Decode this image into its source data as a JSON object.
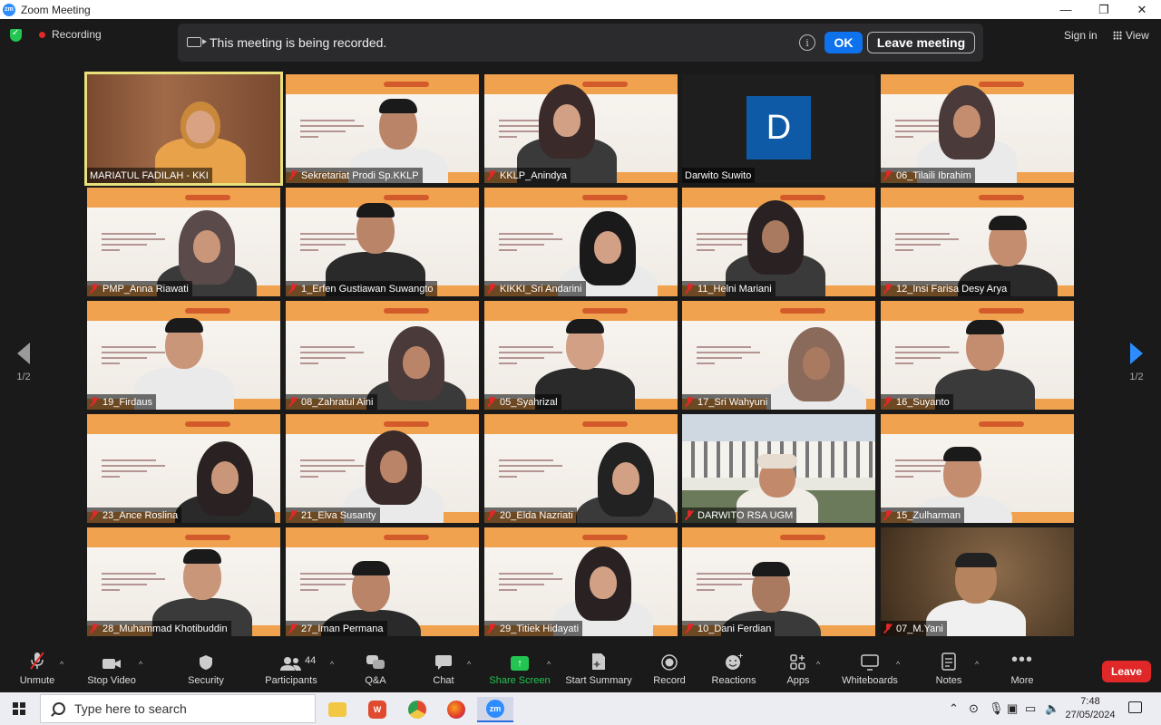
{
  "window": {
    "title": "Zoom Meeting",
    "app_icon": "zm"
  },
  "topbar": {
    "recording_label": "Recording",
    "banner_message": "This meeting is being recorded.",
    "ok_label": "OK",
    "leave_meeting_label": "Leave meeting",
    "signin_label": "Sign in",
    "view_label": "View"
  },
  "paging": {
    "left": "1/2",
    "right": "1/2"
  },
  "participants": [
    "MARIATUL FADILAH - KKI",
    "Sekretariat Prodi Sp.KKLP",
    "KKLP_Anindya",
    "Darwito Suwito",
    "06_Tilaili Ibrahim",
    "PMP_Anna Riawati",
    "1_Erfen Gustiawan Suwangto",
    "KIKKI_Sri Andarini",
    "11_Helni Mariani",
    "12_Insi Farisa Desy Arya",
    "19_Firdaus",
    "08_Zahratul Aini",
    "05_Syahrizal",
    "17_Sri Wahyuni",
    "16_Suyanto",
    "23_Ance Roslina",
    "21_Elva Susanty",
    "20_Elda Nazriati",
    "DARWITO RSA UGM",
    "15_Zulharman",
    "28_Muhammad Khotibuddin",
    "27_Iman Permana",
    "29_Titiek Hidayati",
    "10_Dani Ferdian",
    "07_M.Yani"
  ],
  "darwito_avatar_letter": "D",
  "toolbar": {
    "unmute": "Unmute",
    "stop_video": "Stop Video",
    "security": "Security",
    "participants": "Participants",
    "participants_count": "44",
    "qa": "Q&A",
    "chat": "Chat",
    "share_screen": "Share Screen",
    "start_summary": "Start Summary",
    "record": "Record",
    "reactions": "Reactions",
    "apps": "Apps",
    "whiteboards": "Whiteboards",
    "notes": "Notes",
    "more": "More",
    "leave": "Leave"
  },
  "taskbar": {
    "search_placeholder": "Type here to search",
    "time": "7:48",
    "date": "27/05/2024"
  }
}
